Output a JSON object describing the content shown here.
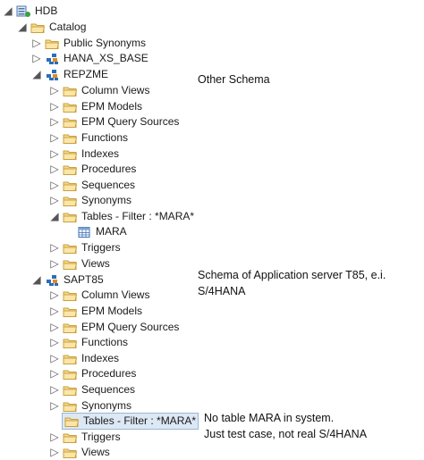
{
  "tree": {
    "root": "HDB",
    "catalog": "Catalog",
    "public_synonyms": "Public Synonyms",
    "hana_xs_base": "HANA_XS_BASE",
    "repzme": "REPZME",
    "repzme_children": {
      "column_views": "Column Views",
      "epm_models": "EPM Models",
      "epm_query_sources": "EPM Query Sources",
      "functions": "Functions",
      "indexes": "Indexes",
      "procedures": "Procedures",
      "sequences": "Sequences",
      "synonyms": "Synonyms",
      "tables_filter": "Tables - Filter : *MARA*",
      "mara": "MARA",
      "triggers": "Triggers",
      "views": "Views"
    },
    "sapt85": "SAPT85",
    "sapt85_children": {
      "column_views": "Column Views",
      "epm_models": "EPM Models",
      "epm_query_sources": "EPM Query Sources",
      "functions": "Functions",
      "indexes": "Indexes",
      "procedures": "Procedures",
      "sequences": "Sequences",
      "synonyms": "Synonyms",
      "tables_filter": "Tables - Filter : *MARA*",
      "triggers": "Triggers",
      "views": "Views"
    }
  },
  "notes": {
    "other_schema": "Other Schema",
    "schema_app_server_line1": "Schema of Application server T85, e.i.",
    "schema_app_server_line2": "S/4HANA",
    "no_table_line1": "No table MARA in system.",
    "no_table_line2": "Just test case, not real S/4HANA"
  },
  "icons": {
    "root": "database-icon",
    "folder": "folder-icon",
    "schema": "schema-icon",
    "table": "table-icon"
  },
  "colors": {
    "folder_fill": "#f7d98a",
    "folder_stroke": "#c9a040",
    "schema_blue": "#2a6fb8",
    "schema_orange": "#e38a1e",
    "selection_bg": "#dde8f5",
    "selection_border": "#9ab6d6"
  }
}
